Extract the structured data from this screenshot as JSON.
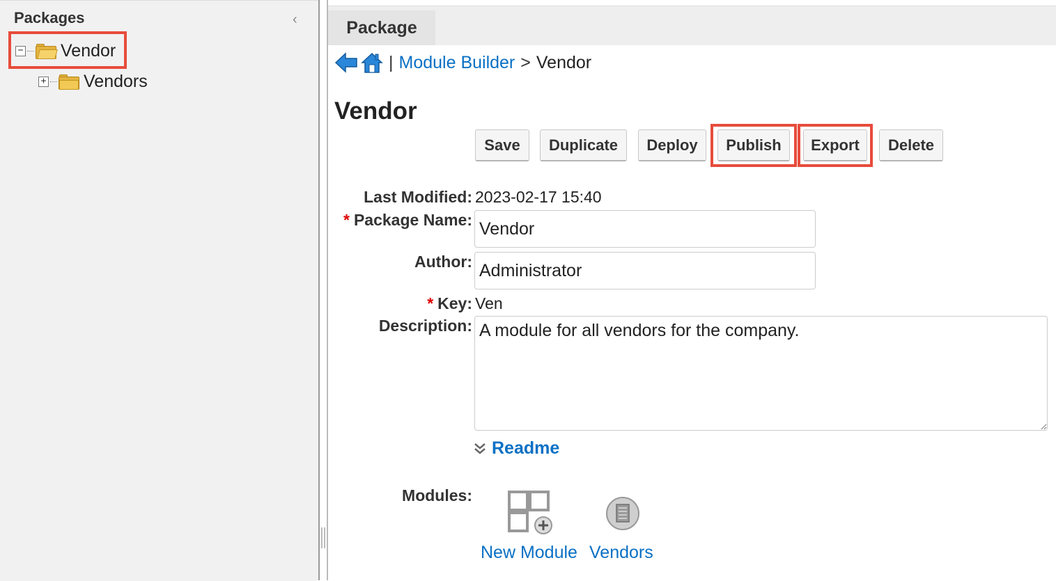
{
  "sidebar": {
    "title": "Packages",
    "tree": [
      {
        "label": "Vendor",
        "toggle": "−",
        "expanded": true
      },
      {
        "label": "Vendors",
        "toggle": "+",
        "expanded": false
      }
    ]
  },
  "tabs": [
    {
      "label": "Package"
    }
  ],
  "breadcrumb": {
    "separator": "|",
    "link": "Module Builder",
    "arrow": ">",
    "current": "Vendor"
  },
  "page_title": "Vendor",
  "toolbar": {
    "save_label": "Save",
    "duplicate_label": "Duplicate",
    "deploy_label": "Deploy",
    "publish_label": "Publish",
    "export_label": "Export",
    "delete_label": "Delete"
  },
  "form": {
    "last_modified_label": "Last Modified:",
    "last_modified_value": "2023-02-17 15:40",
    "package_name_label": "Package Name:",
    "package_name_value": "Vendor",
    "author_label": "Author:",
    "author_value": "Administrator",
    "key_label": "Key:",
    "key_value": "Ven",
    "description_label": "Description:",
    "description_value": "A module for all vendors for the company.",
    "required_marker": "*"
  },
  "readme_label": "Readme",
  "modules": {
    "label": "Modules:",
    "items": [
      {
        "label": "New Module",
        "icon": "new-module-icon"
      },
      {
        "label": "Vendors",
        "icon": "module-icon"
      }
    ]
  },
  "colors": {
    "link": "#0a70c4",
    "highlight": "#e74c3c",
    "required": "#dd0000",
    "folder": "#e3b43f"
  }
}
